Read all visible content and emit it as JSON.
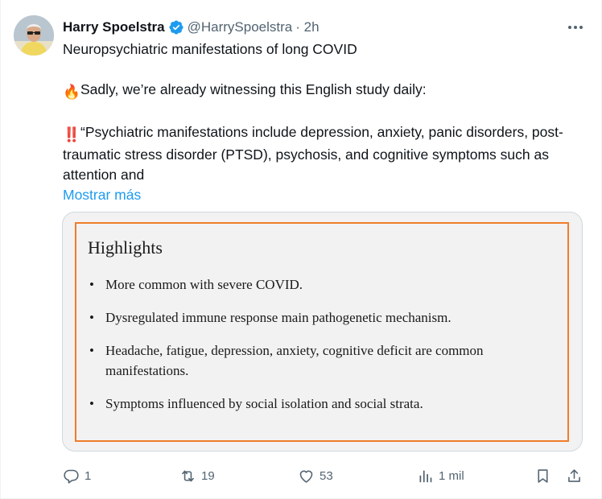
{
  "tweet": {
    "author_name": "Harry Spoelstra",
    "handle": "@HarrySpoelstra",
    "time": "· 2h",
    "line1": "Neuropsychiatric manifestations of long COVID",
    "line2": "Sadly, we’re already witnessing this English study daily:",
    "line3": "“Psychiatric manifestations include depression, anxiety, panic disorders, post-traumatic stress disorder (PTSD), psychosis, and cognitive symptoms such as attention and",
    "show_more": "Mostrar más",
    "emoji_fire": "🔥",
    "emoji_alert": "‼️"
  },
  "card": {
    "title": "Highlights",
    "items": [
      "More common with severe COVID.",
      "Dysregulated immune response main pathogenetic mechanism.",
      "Headache, fatigue, depression, anxiety, cognitive deficit are common manifestations.",
      "Symptoms influenced by social isolation and social strata."
    ],
    "border_color": "#f07d2a"
  },
  "actions": {
    "replies": "1",
    "reposts": "19",
    "likes": "53",
    "views": "1 mil"
  },
  "colors": {
    "accent": "#1d9bf0",
    "muted": "#536471",
    "text": "#0f1419"
  }
}
